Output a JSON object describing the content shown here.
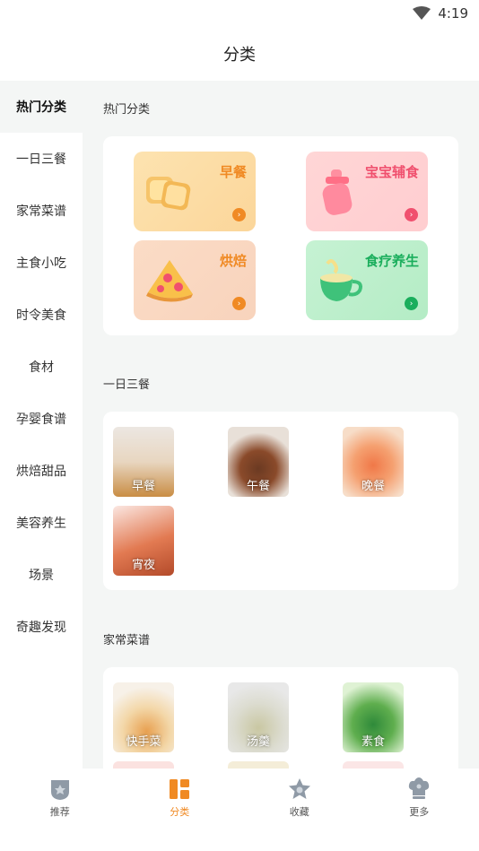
{
  "status": {
    "time": "4:19"
  },
  "header": {
    "title": "分类"
  },
  "sidebar": {
    "items": [
      {
        "label": "热门分类"
      },
      {
        "label": "一日三餐"
      },
      {
        "label": "家常菜谱"
      },
      {
        "label": "主食小吃"
      },
      {
        "label": "时令美食"
      },
      {
        "label": "食材"
      },
      {
        "label": "孕婴食谱"
      },
      {
        "label": "烘焙甜品"
      },
      {
        "label": "美容养生"
      },
      {
        "label": "场景"
      },
      {
        "label": "奇趣发现"
      }
    ]
  },
  "hot": {
    "title": "热门分类",
    "tiles": [
      {
        "label": "早餐",
        "color": "#f08a24"
      },
      {
        "label": "宝宝辅食",
        "color": "#f0506e"
      },
      {
        "label": "烘焙",
        "color": "#f08a24"
      },
      {
        "label": "食疗养生",
        "color": "#1aae5c"
      }
    ]
  },
  "meals": {
    "title": "一日三餐",
    "items": [
      {
        "label": "早餐"
      },
      {
        "label": "午餐"
      },
      {
        "label": "晚餐"
      },
      {
        "label": "宵夜"
      }
    ]
  },
  "home": {
    "title": "家常菜谱",
    "items": [
      {
        "label": "快手菜"
      },
      {
        "label": "汤羹"
      },
      {
        "label": "素食"
      }
    ]
  },
  "tabbar": {
    "items": [
      {
        "label": "推荐",
        "icon": "shield-icon"
      },
      {
        "label": "分类",
        "icon": "category-icon"
      },
      {
        "label": "收藏",
        "icon": "star-icon"
      },
      {
        "label": "更多",
        "icon": "chef-hat-icon"
      }
    ]
  },
  "colors": {
    "accent": "#f08a24",
    "background": "#f4f6f5"
  }
}
